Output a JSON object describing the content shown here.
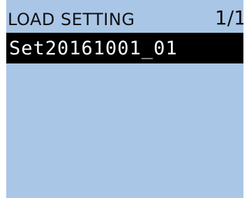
{
  "header": {
    "title": "LOAD SETTING",
    "page": "1/1"
  },
  "files": [
    {
      "label": "Set20161001_01",
      "selected": true
    }
  ],
  "colors": {
    "screen_background": "#a9c6e6",
    "selection_background": "#000000",
    "selection_text": "#ffffff",
    "header_text": "#111111"
  }
}
